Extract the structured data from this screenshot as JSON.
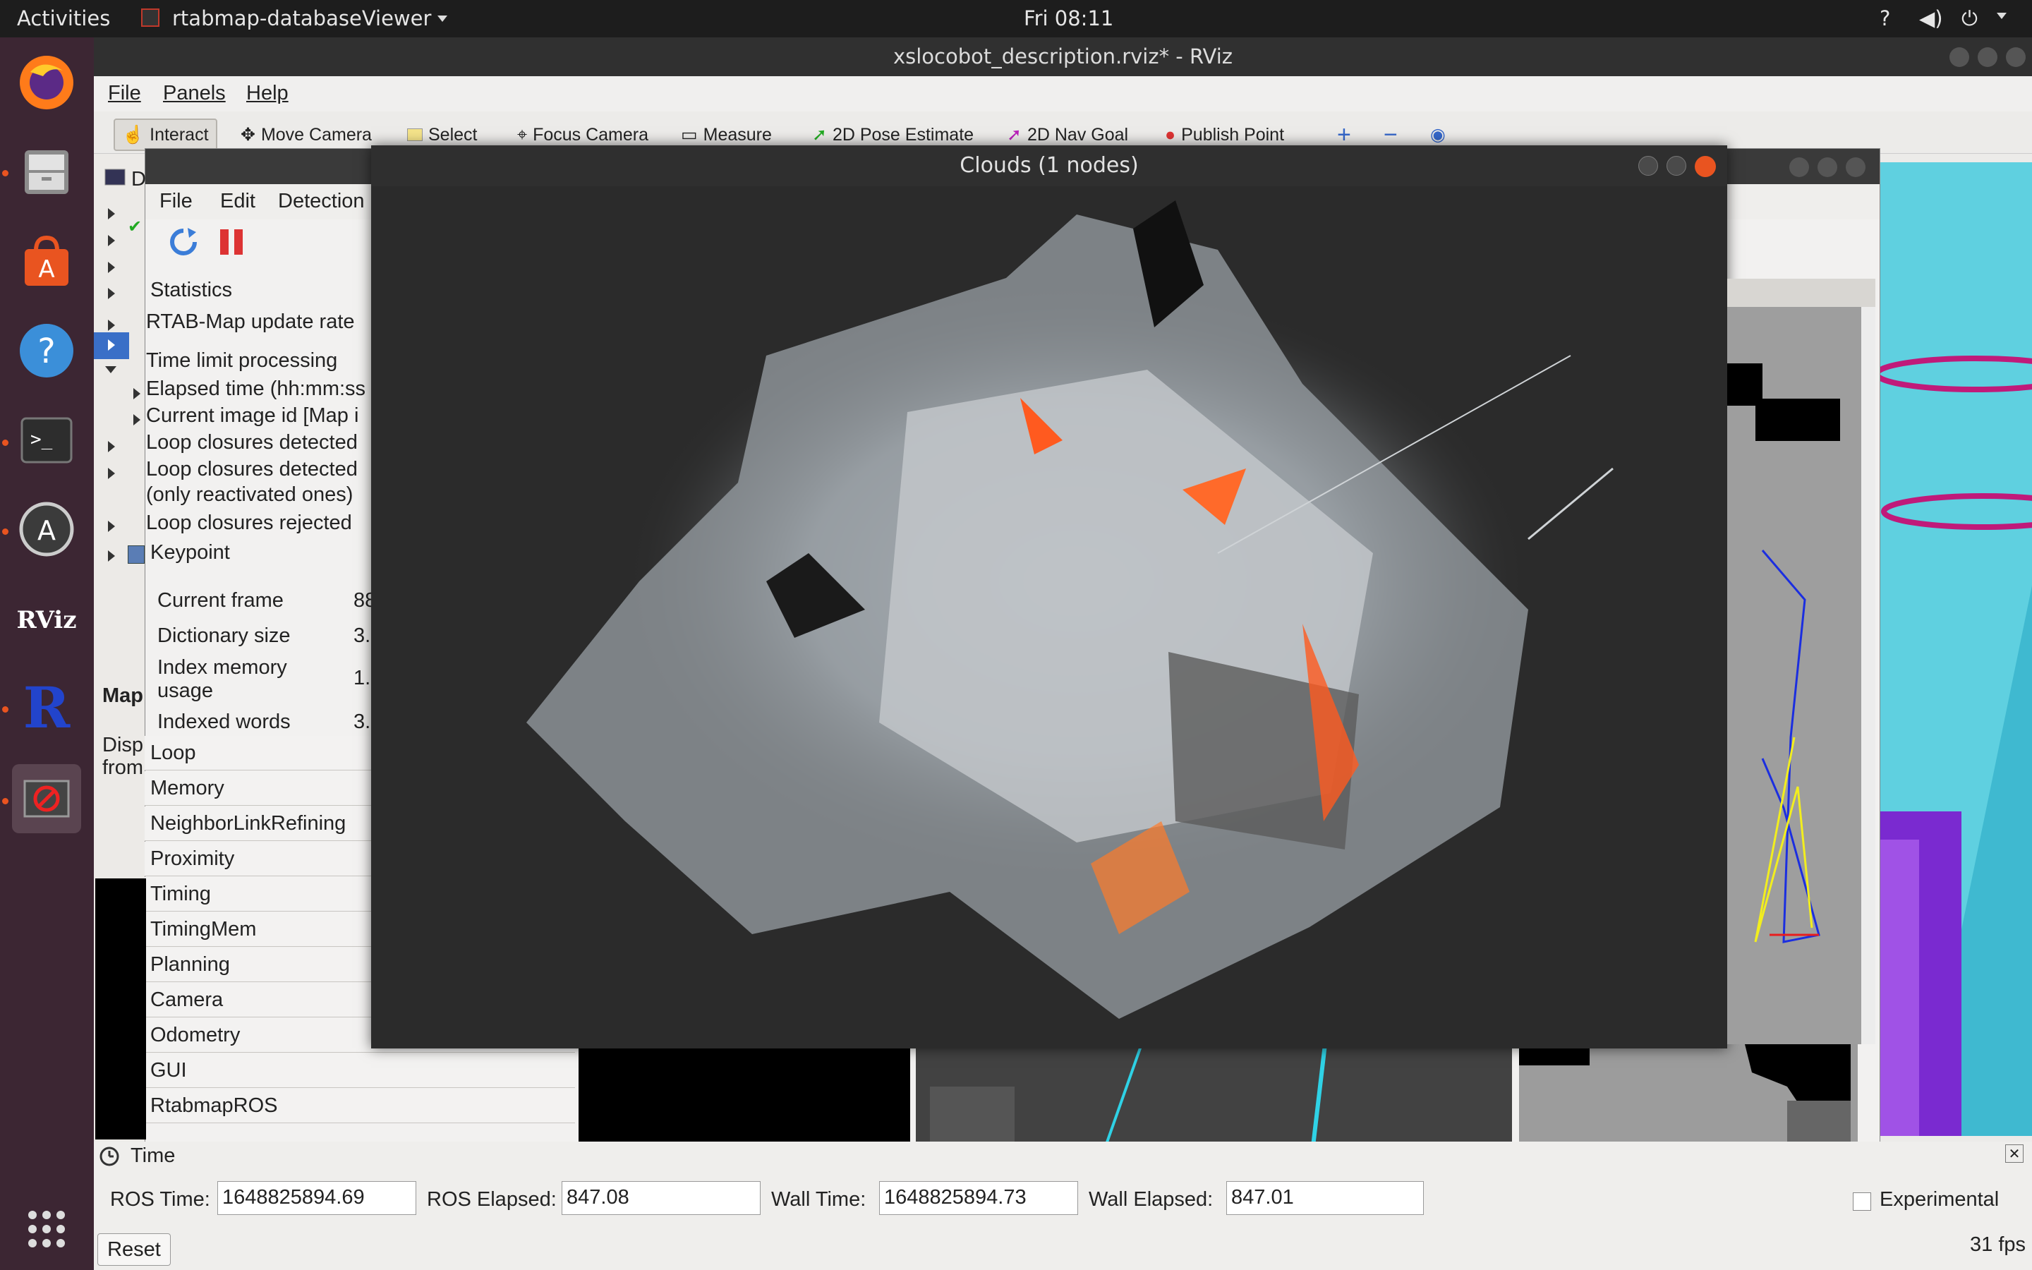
{
  "topbar": {
    "activities": "Activities",
    "app_name": "rtabmap-databaseViewer",
    "clock": "Fri 08:11"
  },
  "dock": {
    "items": [
      "firefox-icon",
      "files-icon",
      "software-icon",
      "help-icon",
      "terminal-icon",
      "updater-icon",
      "rviz-icon",
      "r-icon",
      "blocked-icon"
    ]
  },
  "rviz": {
    "title": "xslocobot_description.rviz* - RViz",
    "menu": [
      "File",
      "Panels",
      "Help"
    ],
    "tools": [
      "Interact",
      "Move Camera",
      "Select",
      "Focus Camera",
      "Measure",
      "2D Pose Estimate",
      "2D Nav Goal",
      "Publish Point"
    ]
  },
  "dbviewer": {
    "menu": [
      "File",
      "Edit",
      "Detection"
    ],
    "tree": {
      "statistics": "Statistics",
      "update_rate": "RTAB-Map update rate",
      "time_limit": "Time limit processing",
      "elapsed": "Elapsed time (hh:mm:ss",
      "current_image": "Current image id [Map i",
      "loop_detected": "Loop closures detected",
      "loop_detected2": "Loop closures detected",
      "reactivated": "(only reactivated ones)",
      "loop_rejected": "Loop closures rejected",
      "keypoint": "Keypoint"
    },
    "stats": [
      {
        "label": "Current frame",
        "value": "88"
      },
      {
        "label": "Dictionary size",
        "value": "3."
      },
      {
        "label": "Index memory usage",
        "value": "1."
      },
      {
        "label": "Indexed words",
        "value": "3."
      }
    ],
    "sections": [
      "Loop",
      "Memory",
      "NeighborLinkRefining",
      "Proximity",
      "Timing",
      "TimingMem",
      "Planning",
      "Camera",
      "Odometry",
      "GUI",
      "RtabmapROS"
    ],
    "map_panel": {
      "title": "Map",
      "desc1": "Disp",
      "desc2": "from"
    }
  },
  "clouds": {
    "title": "Clouds (1 nodes)"
  },
  "timebar": {
    "panel_title": "Time",
    "ros_time_label": "ROS Time:",
    "ros_time": "1648825894.69",
    "ros_elapsed_label": "ROS Elapsed:",
    "ros_elapsed": "847.08",
    "wall_time_label": "Wall Time:",
    "wall_time": "1648825894.73",
    "wall_elapsed_label": "Wall Elapsed:",
    "wall_elapsed": "847.01",
    "experimental": "Experimental",
    "reset": "Reset",
    "fps": "31 fps"
  }
}
